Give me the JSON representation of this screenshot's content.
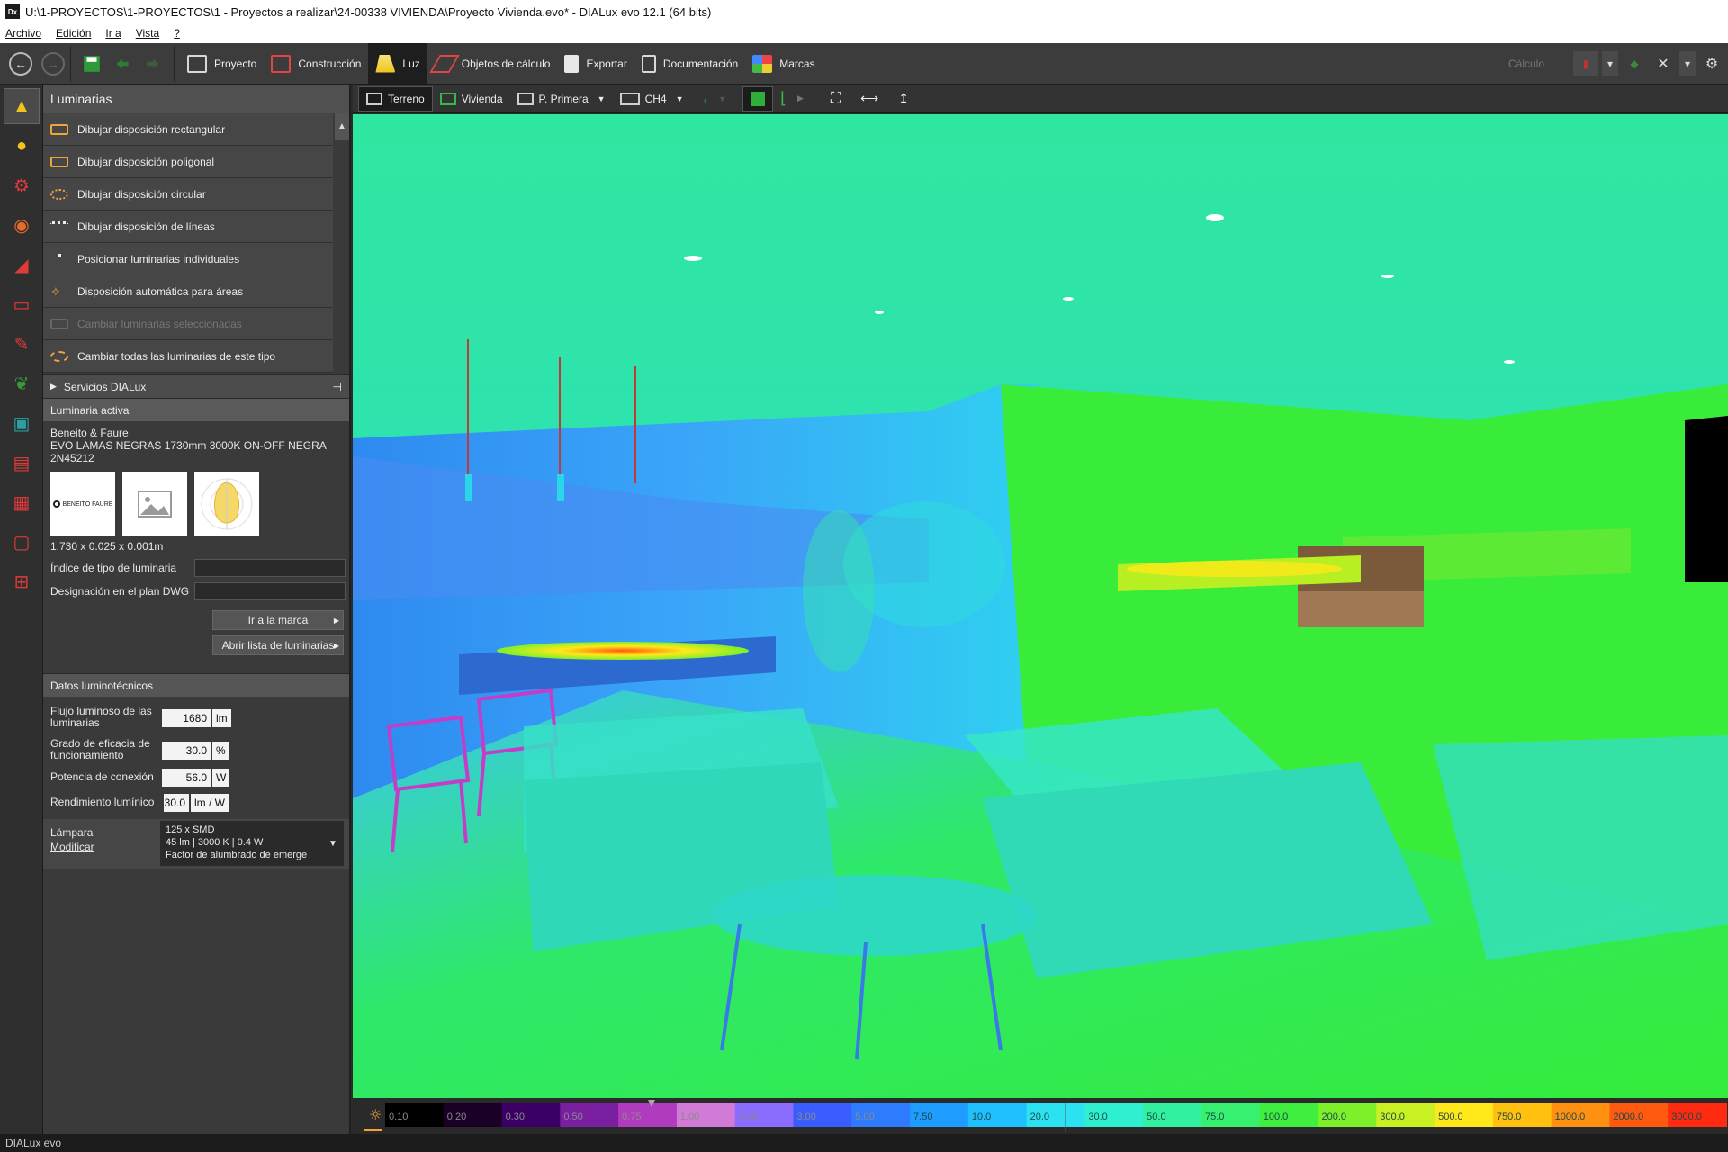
{
  "window": {
    "title": "U:\\1-PROYECTOS\\1-PROYECTOS\\1 - Proyectos a realizar\\24-00338 VIVIENDA\\Proyecto Vivienda.evo* - DIALux evo 12.1  (64 bits)"
  },
  "menu": [
    "Archivo",
    "Edición",
    "Ir a",
    "Vista",
    "?"
  ],
  "tabs": [
    {
      "label": "Proyecto"
    },
    {
      "label": "Construcción"
    },
    {
      "label": "Luz",
      "active": true
    },
    {
      "label": "Objetos de cálculo"
    },
    {
      "label": "Exportar"
    },
    {
      "label": "Documentación"
    },
    {
      "label": "Marcas"
    }
  ],
  "calc_label": "Cálculo",
  "panel": {
    "header": "Luminarias",
    "items": [
      {
        "label": "Dibujar disposición rectangular",
        "enabled": true
      },
      {
        "label": "Dibujar disposición poligonal",
        "enabled": true
      },
      {
        "label": "Dibujar disposición circular",
        "enabled": true
      },
      {
        "label": "Dibujar disposición de líneas",
        "enabled": true
      },
      {
        "label": "Posicionar luminarias individuales",
        "enabled": true
      },
      {
        "label": "Disposición automática para áreas",
        "enabled": true
      },
      {
        "label": "Cambiar luminarias seleccionadas",
        "enabled": false
      },
      {
        "label": "Cambiar todas las luminarias de este tipo",
        "enabled": true
      }
    ],
    "services": "Servicios DIALux",
    "active_section": "Luminaria activa",
    "manufacturer": "Beneito & Faure",
    "product": "EVO LAMAS NEGRAS 1730mm 3000K ON-OFF NEGRA",
    "code": "2N45212",
    "logo_text": "BENEITO FAURE",
    "dimensions": "1.730 x 0.025 x 0.001m",
    "field_tipo": "Índice de tipo de luminaria",
    "field_dwg": "Designación en el plan DWG",
    "btn_marca": "Ir a la marca",
    "btn_lista": "Abrir lista de luminarias",
    "photo_section": "Datos luminotécnicos",
    "flujo_label1": "Flujo luminoso de las",
    "flujo_label2": "luminarias",
    "flujo_value": "1680",
    "flujo_unit": "lm",
    "grado_label1": "Grado de eficacia de",
    "grado_label2": "funcionamiento",
    "grado_value": "30.0",
    "grado_unit": "%",
    "potencia_label": "Potencia de conexión",
    "potencia_value": "56.0",
    "potencia_unit": "W",
    "rend_label": "Rendimiento lumínico",
    "rend_value": "30.0",
    "rend_unit": "lm / W",
    "lampara_label": "Lámpara",
    "modificar": "Modificar",
    "lamp_line1": "125 x SMD",
    "lamp_line2": "45 lm  |  3000 K  |  0.4 W",
    "lamp_line3": "Factor de alumbrado de emerge"
  },
  "view_toolbar": {
    "terreno": "Terreno",
    "vivienda": "Vivienda",
    "planta": "P. Primera",
    "room": "CH4"
  },
  "scale": {
    "ticks": [
      "0.10",
      "0.20",
      "0.30",
      "0.50",
      "0.75",
      "1.00",
      "2.00",
      "3.00",
      "5.00",
      "7.50",
      "10.0",
      "20.0",
      "30.0",
      "50.0",
      "75.0",
      "100.0",
      "200.0",
      "300.0",
      "500.0",
      "750.0",
      "1000.0",
      "2000.0",
      "3000.0"
    ],
    "colors": [
      "#000000",
      "#1a0026",
      "#3b0066",
      "#7a1fa0",
      "#b03bbf",
      "#d27bd6",
      "#8a6cff",
      "#3a5cff",
      "#2f7bff",
      "#1e9cff",
      "#20c0ff",
      "#2de2f0",
      "#2ef0d0",
      "#31f0a0",
      "#38f070",
      "#40ee40",
      "#7df02a",
      "#c8f022",
      "#ffe81a",
      "#ffc010",
      "#ff9010",
      "#ff5a10",
      "#ff2a10"
    ]
  },
  "statusbar": {
    "brand": "DIALux evo"
  }
}
